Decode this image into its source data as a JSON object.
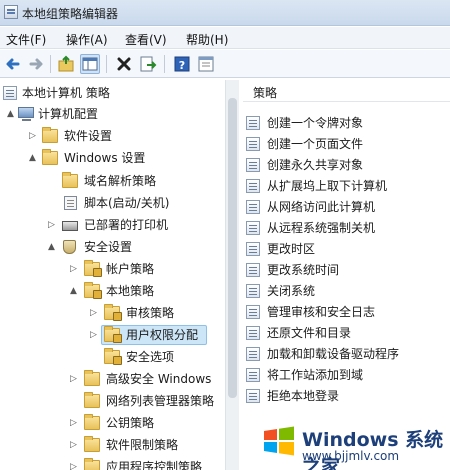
{
  "window": {
    "title": "本地组策略编辑器"
  },
  "menu": [
    "文件(F)",
    "操作(A)",
    "查看(V)",
    "帮助(H)"
  ],
  "toolbar": [
    "back-icon",
    "forward-icon",
    "up-folder-icon",
    "show-hide-tree-icon",
    "delete-icon",
    "export-icon",
    "help-icon",
    "properties-icon"
  ],
  "tree": [
    {
      "label": "本地计算机 策略",
      "icon": "policy-icon",
      "chevron": ""
    },
    {
      "label": "计算机配置",
      "icon": "computer-icon",
      "chevron": "▲"
    },
    {
      "label": "软件设置",
      "icon": "folder-icon",
      "chevron": "▷"
    },
    {
      "label": "Windows 设置",
      "icon": "folder-icon",
      "chevron": "▲"
    },
    {
      "label": "域名解析策略",
      "icon": "folder-icon",
      "chevron": ""
    },
    {
      "label": "脚本(启动/关机)",
      "icon": "document-icon",
      "chevron": ""
    },
    {
      "label": "已部署的打印机",
      "icon": "printer-icon",
      "chevron": "▷"
    },
    {
      "label": "安全设置",
      "icon": "security-icon",
      "chevron": "▲"
    },
    {
      "label": "帐户策略",
      "icon": "folder-lock-icon",
      "chevron": "▷"
    },
    {
      "label": "本地策略",
      "icon": "folder-lock-icon",
      "chevron": "▲"
    },
    {
      "label": "审核策略",
      "icon": "folder-lock-icon",
      "chevron": "▷"
    },
    {
      "label": "用户权限分配",
      "icon": "folder-lock-icon",
      "chevron": "▷",
      "selected": true
    },
    {
      "label": "安全选项",
      "icon": "folder-lock-icon",
      "chevron": ""
    },
    {
      "label": "高级安全 Windows",
      "icon": "folder-icon",
      "chevron": "▷"
    },
    {
      "label": "网络列表管理器策略",
      "icon": "folder-icon",
      "chevron": ""
    },
    {
      "label": "公钥策略",
      "icon": "folder-icon",
      "chevron": "▷"
    },
    {
      "label": "软件限制策略",
      "icon": "folder-icon",
      "chevron": "▷"
    },
    {
      "label": "应用程序控制策略",
      "icon": "folder-icon",
      "chevron": "▷"
    }
  ],
  "list": {
    "header": "策略",
    "items": [
      "创建一个令牌对象",
      "创建一个页面文件",
      "创建永久共享对象",
      "从扩展坞上取下计算机",
      "从网络访问此计算机",
      "从远程系统强制关机",
      "更改时区",
      "更改系统时间",
      "关闭系统",
      "管理审核和安全日志",
      "还原文件和目录",
      "加载和卸载设备驱动程序",
      "将工作站添加到域",
      "拒绝本地登录"
    ]
  },
  "watermark": {
    "title": "Windows 系统之家",
    "url": "www.bjjmlv.com"
  },
  "colors": {
    "selection": "#cde6f7",
    "titlebar": "#c9d9ec",
    "watermark_text": "#1d3f7a"
  }
}
